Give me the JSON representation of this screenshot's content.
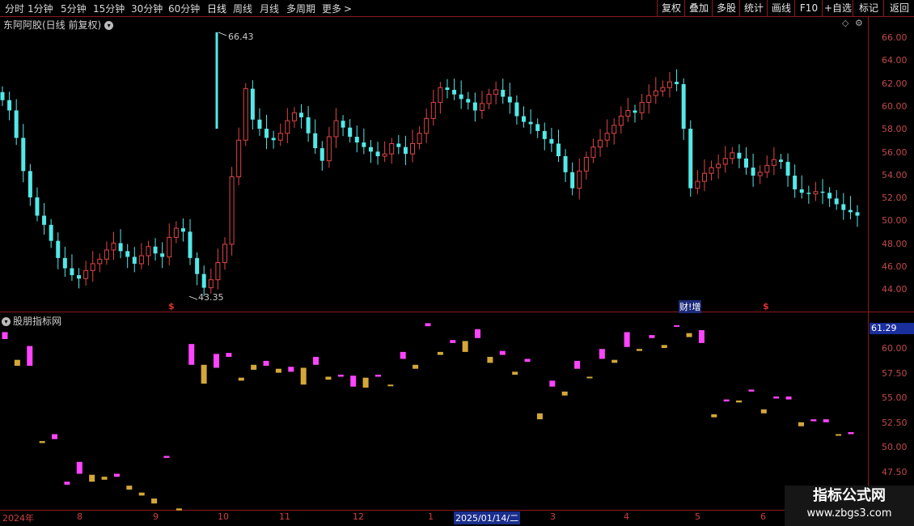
{
  "toolbar": {
    "periods": [
      "分时",
      "1分钟",
      "5分钟",
      "15分钟",
      "30分钟",
      "60分钟",
      "日线",
      "周线",
      "月线",
      "多周期",
      "更多"
    ],
    "active_period": "日线",
    "right_buttons": [
      "复权",
      "叠加",
      "多股",
      "统计",
      "画线",
      "F10",
      "+自选",
      "标记",
      "返回"
    ]
  },
  "main_pane": {
    "title": "东阿阿胶(日线 前复权)",
    "y_labels": [
      "66.00",
      "64.00",
      "62.00",
      "60.00",
      "58.00",
      "56.00",
      "54.00",
      "52.00",
      "50.00",
      "48.00",
      "46.00",
      "44.00"
    ],
    "high_label": "66.43",
    "low_label": "43.35",
    "event_label": "财!增",
    "dollar_marker": "$"
  },
  "indicator_pane": {
    "title": "股朋指标网",
    "current_value": "61.29",
    "y_labels": [
      "60.00",
      "57.50",
      "55.00",
      "52.50",
      "50.00",
      "47.50"
    ]
  },
  "x_axis": {
    "labels": [
      "2024年",
      "8",
      "9",
      "10",
      "11",
      "12",
      "1",
      "2025/01/14/二",
      "3",
      "4",
      "5",
      "6"
    ],
    "selected": "2025/01/14/二"
  },
  "watermark": {
    "line1": "指标公式网",
    "line2": "www.zbgs3.com"
  },
  "colors": {
    "up": "#e04444",
    "down": "#54e8e8",
    "magenta": "#ff44ff",
    "gold": "#d4a838",
    "axis": "#8b1a1a"
  },
  "chart_data": [
    {
      "type": "candlestick",
      "title": "东阿阿胶(日线 前复权)",
      "ylim": [
        43,
        67
      ],
      "highest": 66.43,
      "lowest": 43.35,
      "close_series_approx": [
        60.5,
        59.6,
        57.2,
        54.3,
        52.0,
        50.4,
        49.6,
        48.2,
        46.7,
        45.8,
        45.2,
        44.9,
        45.6,
        46.2,
        46.6,
        47.4,
        48.0,
        47.3,
        46.8,
        46.2,
        46.9,
        47.7,
        47.1,
        46.8,
        48.5,
        49.3,
        49.0,
        46.7,
        45.3,
        44.1,
        44.8,
        46.3,
        47.9,
        53.8,
        57.0,
        61.5,
        58.8,
        58.0,
        57.2,
        57.0,
        57.6,
        58.7,
        59.4,
        59.0,
        57.6,
        56.3,
        55.2,
        57.3,
        58.7,
        58.1,
        57.3,
        56.8,
        56.4,
        56.0,
        55.6,
        55.8,
        56.7,
        56.4,
        55.8,
        56.7,
        57.6,
        58.9,
        60.3,
        61.6,
        61.4,
        61.0,
        60.6,
        60.3,
        59.6,
        60.2,
        61.0,
        61.4,
        60.8,
        60.3,
        59.1,
        58.6,
        58.4,
        57.8,
        57.1,
        56.7,
        55.6,
        54.2,
        52.8,
        54.3,
        55.5,
        56.4,
        57.0,
        57.6,
        58.3,
        59.1,
        59.6,
        59.4,
        60.3,
        60.9,
        61.3,
        61.6,
        62.1,
        61.9,
        58.0,
        52.8,
        53.4,
        54.1,
        54.6,
        54.9,
        55.4,
        55.9,
        55.4,
        54.6,
        53.9,
        54.2,
        54.8,
        55.3,
        55.1,
        53.9,
        52.7,
        52.4,
        52.3,
        52.5,
        52.4,
        51.9,
        51.4,
        50.9,
        50.7,
        50.4
      ]
    },
    {
      "type": "bar",
      "title": "股朋指标网",
      "ylim": [
        46,
        62
      ],
      "segments": [
        {
          "color": "magenta",
          "from": 60.9,
          "to": 61.6
        },
        {
          "color": "gold",
          "from": 58.2,
          "to": 58.8
        },
        {
          "color": "magenta",
          "from": 58.2,
          "to": 60.2
        },
        {
          "color": "gold",
          "from": 50.4,
          "to": 50.6
        },
        {
          "color": "magenta",
          "from": 50.8,
          "to": 51.3
        },
        {
          "color": "magenta",
          "from": 46.2,
          "to": 46.5
        },
        {
          "color": "magenta",
          "from": 47.3,
          "to": 48.5
        },
        {
          "color": "gold",
          "from": 46.5,
          "to": 47.2
        },
        {
          "color": "gold",
          "from": 46.7,
          "to": 47.0
        },
        {
          "color": "magenta",
          "from": 47.0,
          "to": 47.3
        },
        {
          "color": "gold",
          "from": 45.7,
          "to": 46.1
        },
        {
          "color": "gold",
          "from": 45.1,
          "to": 45.4
        },
        {
          "color": "gold",
          "from": 44.3,
          "to": 44.8
        },
        {
          "color": "magenta",
          "from": 48.9,
          "to": 49.1
        },
        {
          "color": "gold",
          "from": 43.6,
          "to": 43.8
        },
        {
          "color": "magenta",
          "from": 58.3,
          "to": 60.4
        },
        {
          "color": "gold",
          "from": 56.4,
          "to": 58.3
        },
        {
          "color": "magenta",
          "from": 58.0,
          "to": 59.4
        },
        {
          "color": "magenta",
          "from": 59.1,
          "to": 59.5
        },
        {
          "color": "gold",
          "from": 56.7,
          "to": 57.0
        },
        {
          "color": "gold",
          "from": 57.8,
          "to": 58.3
        },
        {
          "color": "magenta",
          "from": 58.2,
          "to": 58.7
        },
        {
          "color": "gold",
          "from": 57.5,
          "to": 57.9
        },
        {
          "color": "magenta",
          "from": 57.6,
          "to": 58.1
        },
        {
          "color": "gold",
          "from": 56.3,
          "to": 58.0
        },
        {
          "color": "magenta",
          "from": 58.3,
          "to": 59.1
        },
        {
          "color": "gold",
          "from": 56.8,
          "to": 57.1
        },
        {
          "color": "magenta",
          "from": 57.1,
          "to": 57.3
        },
        {
          "color": "magenta",
          "from": 56.1,
          "to": 57.2
        },
        {
          "color": "gold",
          "from": 56.0,
          "to": 57.0
        },
        {
          "color": "magenta",
          "from": 57.1,
          "to": 57.3
        },
        {
          "color": "gold",
          "from": 56.2,
          "to": 56.3
        },
        {
          "color": "magenta",
          "from": 58.9,
          "to": 59.6
        },
        {
          "color": "gold",
          "from": 57.9,
          "to": 58.3
        },
        {
          "color": "magenta",
          "from": 62.2,
          "to": 62.5
        },
        {
          "color": "gold",
          "from": 59.3,
          "to": 59.6
        },
        {
          "color": "magenta",
          "from": 60.5,
          "to": 60.8
        },
        {
          "color": "gold",
          "from": 59.6,
          "to": 60.7
        },
        {
          "color": "magenta",
          "from": 61.0,
          "to": 61.9
        },
        {
          "color": "gold",
          "from": 58.5,
          "to": 59.1
        },
        {
          "color": "magenta",
          "from": 59.3,
          "to": 59.7
        },
        {
          "color": "gold",
          "from": 57.3,
          "to": 57.6
        },
        {
          "color": "magenta",
          "from": 58.6,
          "to": 58.9
        },
        {
          "color": "gold",
          "from": 52.8,
          "to": 53.4
        },
        {
          "color": "magenta",
          "from": 56.1,
          "to": 56.7
        },
        {
          "color": "gold",
          "from": 55.2,
          "to": 55.6
        },
        {
          "color": "magenta",
          "from": 57.9,
          "to": 58.7
        },
        {
          "color": "gold",
          "from": 57.0,
          "to": 57.1
        },
        {
          "color": "magenta",
          "from": 58.9,
          "to": 59.9
        },
        {
          "color": "gold",
          "from": 58.5,
          "to": 58.8
        },
        {
          "color": "magenta",
          "from": 60.1,
          "to": 61.6
        },
        {
          "color": "gold",
          "from": 59.7,
          "to": 59.9
        },
        {
          "color": "magenta",
          "from": 61.0,
          "to": 61.3
        },
        {
          "color": "gold",
          "from": 60.0,
          "to": 60.3
        },
        {
          "color": "magenta",
          "from": 62.2,
          "to": 62.3
        },
        {
          "color": "gold",
          "from": 61.1,
          "to": 61.5
        },
        {
          "color": "magenta",
          "from": 60.5,
          "to": 61.8
        },
        {
          "color": "gold",
          "from": 53.0,
          "to": 53.3
        },
        {
          "color": "magenta",
          "from": 54.6,
          "to": 54.8
        },
        {
          "color": "gold",
          "from": 54.5,
          "to": 54.7
        },
        {
          "color": "magenta",
          "from": 55.6,
          "to": 55.8
        },
        {
          "color": "gold",
          "from": 53.4,
          "to": 53.8
        },
        {
          "color": "magenta",
          "from": 54.9,
          "to": 55.1
        },
        {
          "color": "magenta",
          "from": 54.8,
          "to": 55.1
        },
        {
          "color": "gold",
          "from": 52.1,
          "to": 52.5
        },
        {
          "color": "magenta",
          "from": 52.6,
          "to": 52.8
        },
        {
          "color": "magenta",
          "from": 52.5,
          "to": 52.8
        },
        {
          "color": "gold",
          "from": 51.2,
          "to": 51.3
        },
        {
          "color": "magenta",
          "from": 51.3,
          "to": 51.5
        }
      ]
    }
  ]
}
